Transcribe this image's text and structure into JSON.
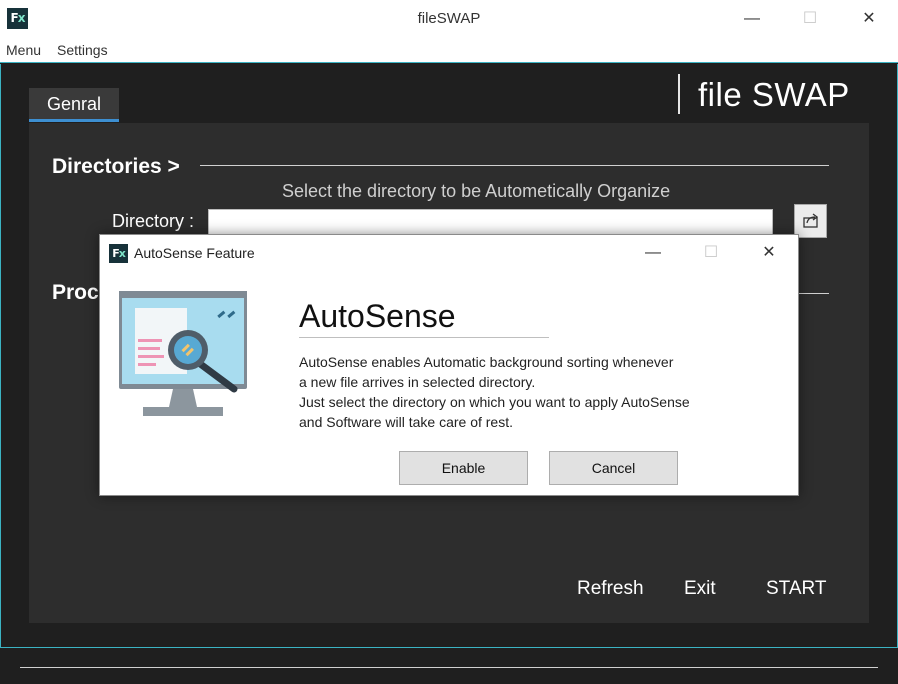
{
  "window": {
    "title": "fileSWAP",
    "logo_text": "Fx",
    "minimize_glyph": "—",
    "maximize_glyph": "☐",
    "close_glyph": "✕"
  },
  "menubar": {
    "items": [
      "Menu",
      "Settings"
    ]
  },
  "brand": {
    "title": "file SWAP"
  },
  "tabs": [
    {
      "label": "Genral",
      "active": true
    }
  ],
  "directories": {
    "heading": "Directories  >",
    "hint": "Select the directory to be Autometically Organize",
    "label": "Directory :",
    "value": "",
    "browse_icon": "share-export-icon"
  },
  "process": {
    "heading_visible": "Proc"
  },
  "actions": {
    "refresh": "Refresh",
    "exit": "Exit",
    "start": "START"
  },
  "dialog": {
    "title": "AutoSense Feature",
    "logo_text": "Fx",
    "illustration": "computer-magnifier-icon",
    "heading": "AutoSense",
    "lines": [
      "AutoSense enables Automatic background sorting whenever",
      "a new file arrives in selected directory.",
      "Just select the directory on which you want to apply AutoSense",
      "and Software will take care of rest."
    ],
    "buttons": {
      "enable": "Enable",
      "cancel": "Cancel"
    }
  },
  "colors": {
    "accent": "#3bb3c3",
    "tab_underline": "#3d8fd1",
    "app_bg": "#1f1f1f",
    "panel_bg": "#2d2d2d",
    "logo_bg": "#17323a"
  }
}
